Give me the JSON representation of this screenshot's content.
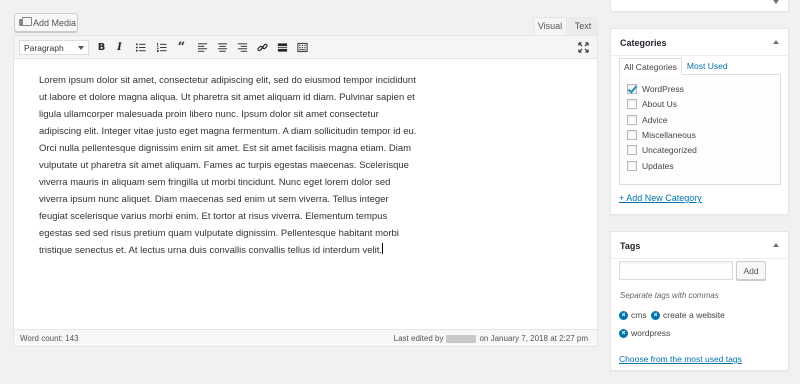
{
  "editor": {
    "add_media_label": "Add Media",
    "tabs": {
      "visual": "Visual",
      "text": "Text"
    },
    "format_select": "Paragraph",
    "toolbar_icons": [
      "bold-icon",
      "italic-icon",
      "bullet-list-icon",
      "numbered-list-icon",
      "blockquote-icon",
      "align-left-icon",
      "align-center-icon",
      "align-right-icon",
      "link-icon",
      "read-more-icon",
      "toolbar-toggle-icon",
      "fullscreen-icon"
    ],
    "content": "Lorem ipsum dolor sit amet, consectetur adipiscing elit, sed do eiusmod tempor incididunt ut labore et dolore magna aliqua. Ut pharetra sit amet aliquam id diam. Pulvinar sapien et ligula ullamcorper malesuada proin libero nunc. Ipsum dolor sit amet consectetur adipiscing elit. Integer vitae justo eget magna fermentum. A diam sollicitudin tempor id eu. Orci nulla pellentesque dignissim enim sit amet. Est sit amet facilisis magna etiam. Diam vulputate ut pharetra sit amet aliquam. Fames ac turpis egestas maecenas. Scelerisque viverra mauris in aliquam sem fringilla ut morbi tincidunt. Nunc eget lorem dolor sed viverra ipsum nunc aliquet. Diam maecenas sed enim ut sem viverra. Tellus integer feugiat scelerisque varius morbi enim. Et tortor at risus viverra. Elementum tempus egestas sed sed risus pretium quam vulputate dignissim. Pellentesque habitant morbi tristique senectus et. At lectus urna duis convallis convallis tellus id interdum velit.",
    "word_count": "Word count: 143",
    "last_edited_prefix": "Last edited by",
    "last_edited_suffix": "on January 7, 2018 at 2:27 pm"
  },
  "categories": {
    "title": "Categories",
    "tab_all": "All Categories",
    "tab_most_used": "Most Used",
    "items": [
      {
        "label": "WordPress",
        "checked": true
      },
      {
        "label": "About Us",
        "checked": false
      },
      {
        "label": "Advice",
        "checked": false
      },
      {
        "label": "Miscellaneous",
        "checked": false
      },
      {
        "label": "Uncategorized",
        "checked": false
      },
      {
        "label": "Updates",
        "checked": false
      }
    ],
    "add_new": "+ Add New Category"
  },
  "tags": {
    "title": "Tags",
    "input_value": "",
    "add_button": "Add",
    "hint": "Separate tags with commas",
    "items": [
      "cms",
      "create a website",
      "wordpress"
    ],
    "choose_link": "Choose from the most used tags"
  },
  "colors": {
    "link": "#0073aa",
    "checkbox_check": "#1e8cbe"
  }
}
